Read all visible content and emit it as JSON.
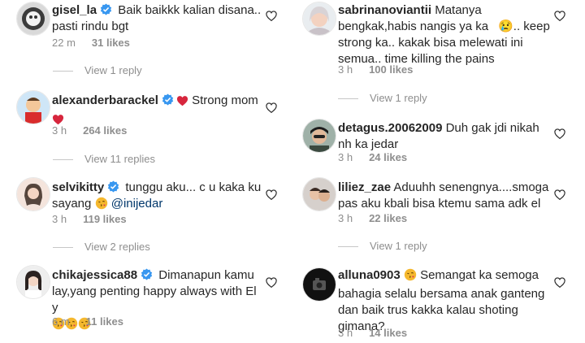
{
  "colors": {
    "text": "#262626",
    "secondary": "#8e8e8e",
    "verified": "#3897f0",
    "mention": "#00376b",
    "heart": "#e0245e"
  },
  "left_column": [
    {
      "username": "gisel_la",
      "verified": true,
      "text": "Baik baikkk kalian disana.. pasti rindu bgt",
      "time": "22 m",
      "likes": "31 likes",
      "view_replies": "View 1 reply"
    },
    {
      "username": "alexanderbarackel",
      "verified": true,
      "text": "Strong mom",
      "emoji": "red-heart",
      "time": "3 h",
      "likes": "264 likes",
      "view_replies": "View 11 replies"
    },
    {
      "username": "selvikitty",
      "verified": true,
      "text": "tunggu aku... c u kaka ku sayang",
      "emoji": "kissing-face",
      "mention": "@inijedar",
      "time": "3 h",
      "likes": "119 likes",
      "view_replies": "View 2 replies"
    },
    {
      "username": "chikajessica88",
      "verified": true,
      "text": "Dimanapun kamu lay,yang penting happy always with El y",
      "emoji": "kissing-face x3",
      "time": "6 m",
      "likes": "11 likes"
    }
  ],
  "right_column": [
    {
      "username": "sabrinanoviantii",
      "verified": false,
      "text": "Matanya bengkak,habis nangis ya ka😢.. keep strong ka.. kakak bisa melewati ini semua.. time killing the pains",
      "time": "3 h",
      "likes": "100 likes",
      "view_replies": "View 1 reply"
    },
    {
      "username": "detagus.20062009",
      "verified": false,
      "text": "Duh gak jdi nikah nh ka jedar",
      "time": "3 h",
      "likes": "24 likes"
    },
    {
      "username": "liliez_zae",
      "verified": false,
      "text": "Aduuhh senengnya....smoga pas aku kbali bisa ktemu sama adk el",
      "time": "3 h",
      "likes": "22 likes",
      "view_replies": "View 1 reply"
    },
    {
      "username": "alluna0903",
      "verified": false,
      "emoji": "kissing-face",
      "text": "Semangat ka semoga bahagia selalu bersama anak ganteng dan baik trus kakka kalau shoting gimana?",
      "time": "3 h",
      "likes": "14 likes"
    }
  ]
}
